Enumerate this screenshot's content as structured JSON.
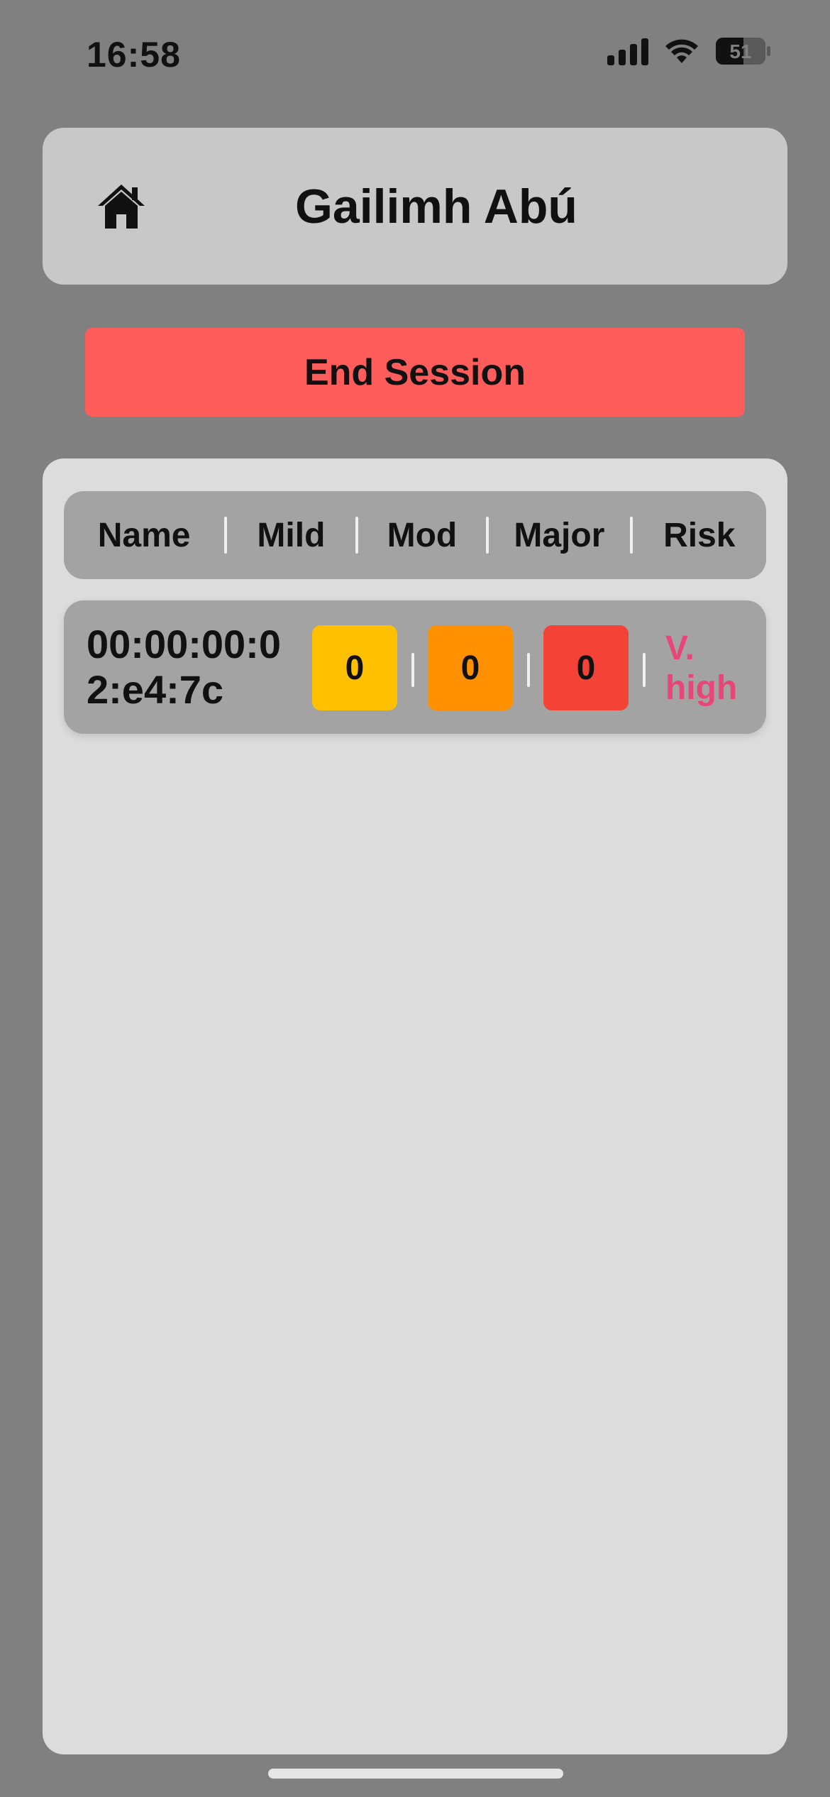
{
  "status_bar": {
    "time": "16:58",
    "battery_level": "51",
    "icons": [
      "signal-icon",
      "wifi-icon",
      "battery-icon"
    ]
  },
  "header": {
    "home_icon": "home-icon",
    "title": "Gailimh Abú"
  },
  "actions": {
    "end_session_label": "End Session",
    "end_session_color": "#ff5c5c"
  },
  "table": {
    "columns": [
      "Name",
      "Mild",
      "Mod",
      "Major",
      "Risk"
    ],
    "rows": [
      {
        "name": "00:00:00:02:e4:7c",
        "mild": "0",
        "mod": "0",
        "major": "0",
        "risk": "V. high"
      }
    ]
  },
  "colors": {
    "background": "#808080",
    "mild": "#ffc000",
    "mod": "#ff9100",
    "major": "#f44336",
    "risk_text": "#e8457a"
  }
}
